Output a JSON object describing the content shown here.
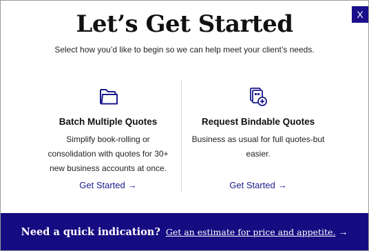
{
  "modal": {
    "close_label": "X",
    "title": "Let’s Get Started",
    "subtitle": "Select how you’d like to begin so we can help meet your client’s needs."
  },
  "options": [
    {
      "icon": "folder-icon",
      "heading": "Batch Multiple Quotes",
      "desc_lines": [
        "Simplify book-rolling or",
        "consolidation with quotes for 30+",
        "new business accounts at once."
      ],
      "cta_label": "Get Started",
      "cta_arrow": "→"
    },
    {
      "icon": "add-quote-icon",
      "heading": "Request Bindable Quotes",
      "desc_lines": [
        "Business as usual for full quotes-but",
        "easier."
      ],
      "cta_label": "Get Started",
      "cta_arrow": "→"
    }
  ],
  "footer": {
    "question": "Need a quick indication?",
    "link_label": "Get an estimate for price and appetite.",
    "arrow": "→"
  },
  "colors": {
    "accent": "#150c82",
    "link": "#1a1a8c"
  }
}
